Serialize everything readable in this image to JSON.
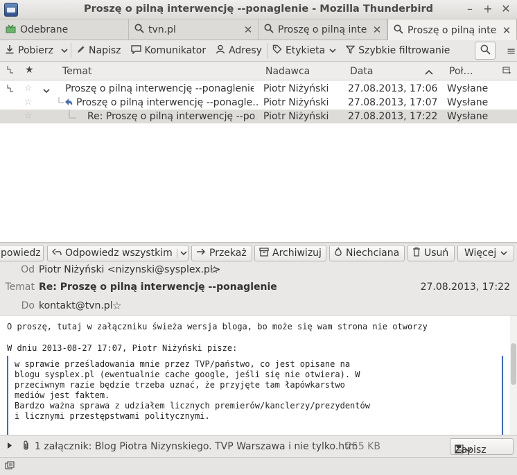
{
  "window": {
    "title": "Proszę o pilną interwencję --ponaglenie - Mozilla Thunderbird",
    "minimize": "–",
    "maximize": "+",
    "close": "✕"
  },
  "tabs": [
    {
      "label": "Odebrane",
      "icon": "inbox-icon"
    },
    {
      "label": "tvn.pl",
      "icon": "search-icon",
      "close": "✕"
    },
    {
      "label": "Proszę o pilną inte",
      "icon": "search-icon",
      "close": "✕"
    },
    {
      "label": "Proszę o pilną inte",
      "icon": "search-icon",
      "close": "✕",
      "active": true
    }
  ],
  "toolbar": {
    "get": "Pobierz",
    "write": "Napisz",
    "chat": "Komunikator",
    "address": "Adresy",
    "tag": "Etykieta",
    "filter": "Szybkie filtrowanie"
  },
  "columns": {
    "subject": "Temat",
    "sender": "Nadawca",
    "date": "Data",
    "folder": "Poł…"
  },
  "messages": [
    {
      "subject": "Proszę o pilną interwencję --ponaglenie",
      "sender": "Piotr Niżyński",
      "date": "27.08.2013, 17:06",
      "folder": "Wysłane"
    },
    {
      "subject": "Proszę o pilną interwencję --ponagle…",
      "sender": "Piotr Niżyński",
      "date": "27.08.2013, 17:07",
      "folder": "Wysłane"
    },
    {
      "subject": "Re: Proszę o pilną interwencję --po…",
      "sender": "Piotr Niżyński",
      "date": "27.08.2013, 17:22",
      "folder": "Wysłane"
    }
  ],
  "actions": {
    "reply": "powiedz",
    "reply_all": "Odpowiedz wszystkim",
    "forward": "Przekaż",
    "archive": "Archiwizuj",
    "junk": "Niechciana",
    "delete": "Usuń",
    "more": "Więcej"
  },
  "headers": {
    "from_label": "Od",
    "from_value": "Piotr Niżyński <nizynski@sysplex.pl>",
    "subject_label": "Temat",
    "subject_value": "Re: Proszę o pilną interwencję --ponaglenie",
    "date_value": "27.08.2013, 17:22",
    "to_label": "Do",
    "to_value": "kontakt@tvn.pl"
  },
  "body": {
    "line1": "O proszę, tutaj w załączniku świeża wersja bloga, bo może się wam strona nie otworzy",
    "line2": "W dniu 2013-08-27 17:07, Piotr Niżyński pisze:",
    "quote": [
      "w sprawie prześladowania mnie przez TVP/państwo, co jest opisane na",
      "blogu sysplex.pl (ewentualnie cache google, jeśli się nie otwiera). W",
      "przeciwnym razie będzie trzeba uznać, że przyjęte tam łapówkarstwo",
      "mediów jest faktem.",
      "Bardzo ważna sprawa z udziałem licznych premierów/kanclerzy/prezydentów",
      "i licznymi przestępstwami politycznymi."
    ]
  },
  "attachment": {
    "summary": "1 załącznik: Blog Piotra Nizynskiego. TVP Warszawa i nie tylko.htm",
    "size": "255 KB",
    "save": "Zapisz"
  }
}
